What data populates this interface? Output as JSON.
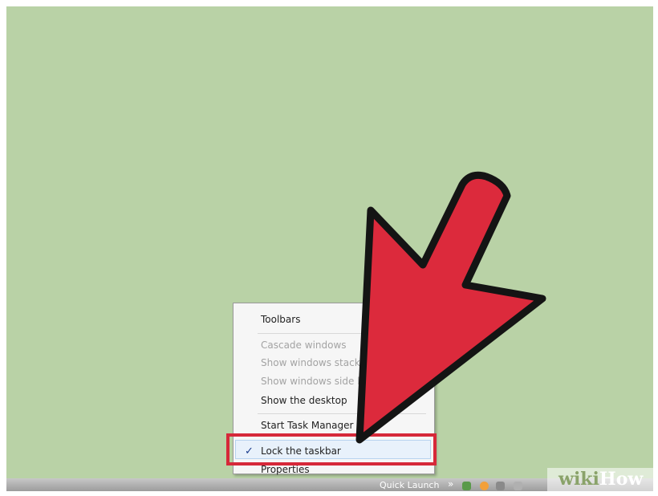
{
  "context_menu": {
    "items": [
      {
        "label": "Toolbars",
        "state": "enabled"
      },
      {
        "label": "Cascade windows",
        "state": "disabled"
      },
      {
        "label": "Show windows stack",
        "state": "disabled"
      },
      {
        "label": "Show windows side b",
        "state": "disabled"
      },
      {
        "label": "Show the desktop",
        "state": "enabled"
      },
      {
        "label": "Start Task Manager",
        "state": "enabled"
      },
      {
        "label": "Lock the taskbar",
        "state": "checked"
      },
      {
        "label": "Properties",
        "state": "enabled"
      }
    ],
    "check_mark": "✓"
  },
  "taskbar": {
    "quick_launch_label": "Quick Launch",
    "chevron": "»"
  },
  "watermark": {
    "wiki": "wiki",
    "how": "How"
  },
  "colors": {
    "desktop": "#b9d2a6",
    "arrow": "#dc2a3c",
    "highlight_border": "#d62839"
  }
}
